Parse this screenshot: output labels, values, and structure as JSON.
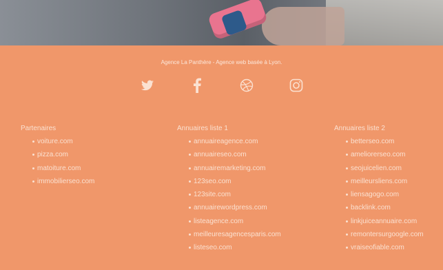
{
  "footer": {
    "tagline": "Agence La Panthère - Agence web basée à Lyon.",
    "social": [
      {
        "name": "twitter-icon"
      },
      {
        "name": "facebook-icon"
      },
      {
        "name": "dribbble-icon"
      },
      {
        "name": "instagram-icon"
      }
    ],
    "columns": [
      {
        "title": "Partenaires",
        "links": [
          "voiture.com",
          "pizza.com",
          "matoiture.com",
          "immobilierseo.com"
        ]
      },
      {
        "title": "Annuaires liste 1",
        "links": [
          "annuaireagence.com",
          "annuaireseo.com",
          "annuairemarketing.com",
          "123seo.com",
          "123site.com",
          "annuairewordpress.com",
          "listeagence.com",
          "meilleuresagencesparis.com",
          "listeseo.com"
        ]
      },
      {
        "title": "Annuaires liste 2",
        "links": [
          "betterseo.com",
          "ameliorerseo.com",
          "seojuicelien.com",
          "meilleursliens.com",
          "liensagogo.com",
          "backlink.com",
          "linkjuiceannuaire.com",
          "remontersurgoogle.com",
          "vraiseofiable.com"
        ]
      }
    ],
    "text_color": "#fbe1d1",
    "background_color": "#f0976a"
  }
}
